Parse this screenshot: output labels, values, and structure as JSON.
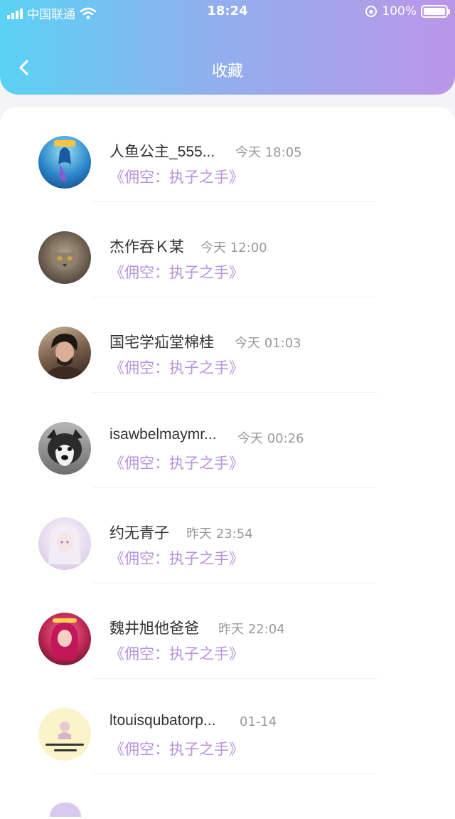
{
  "status_bar": {
    "carrier": "中国联通",
    "time": "18:24",
    "battery": "100%"
  },
  "header": {
    "title": "收藏"
  },
  "items": [
    {
      "name": "人鱼公主_555...",
      "time": "今天 18:05",
      "work": "《佣空：执子之手》"
    },
    {
      "name": "杰作吞Ｋ某",
      "time": "今天 12:00",
      "work": "《佣空：执子之手》"
    },
    {
      "name": "国宅学疝堂棉桂",
      "time": "今天 01:03",
      "work": "《佣空：执子之手》"
    },
    {
      "name": "isawbelmaymr...",
      "time": "今天 00:26",
      "work": "《佣空：执子之手》"
    },
    {
      "name": "约无青子",
      "time": "昨天 23:54",
      "work": "《佣空：执子之手》"
    },
    {
      "name": "魏井旭他爸爸",
      "time": "昨天 22:04",
      "work": "《佣空：执子之手》"
    },
    {
      "name": "ltouisqubatorp...",
      "time": "01-14",
      "work": "《佣空：执子之手》"
    }
  ]
}
